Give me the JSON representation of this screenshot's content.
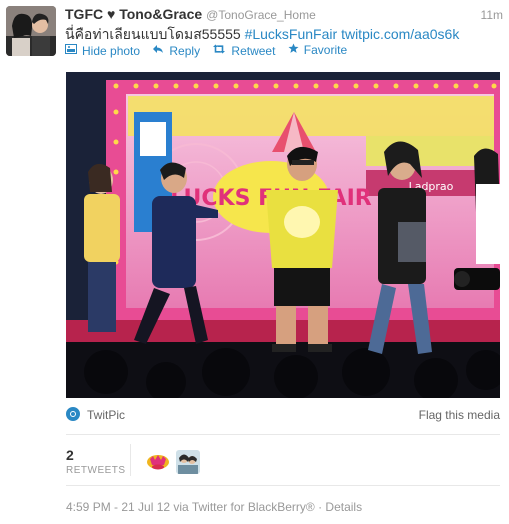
{
  "tweet": {
    "display_name": "TGFC ♥ Tono&Grace",
    "screen_name": "@TonoGrace_Home",
    "time_ago": "11m",
    "text_plain": "นี่คือท่าเลียนแบบโดมส55555",
    "hashtag": "#LucksFunFair",
    "link": "twitpic.com/aa0s6k"
  },
  "actions": {
    "hide_photo": "Hide photo",
    "reply": "Reply",
    "retweet": "Retweet",
    "favorite": "Favorite"
  },
  "media": {
    "banner_text": "LUCKS FUN FAIR",
    "location_text": "Ladprao",
    "provider": "TwitPic",
    "flag": "Flag this media"
  },
  "stats": {
    "retweet_count": "2",
    "retweets_label": "RETWEETS"
  },
  "meta": {
    "time": "4:59 PM - 21 Jul 12 via Twitter for BlackBerry®",
    "separator": "·",
    "details": "Details"
  },
  "colors": {
    "link": "#2a88c4",
    "text": "#333333",
    "muted": "#999999"
  },
  "icons": [
    "photo-icon",
    "reply-icon",
    "retweet-icon",
    "favorite-icon",
    "twitpic-icon"
  ]
}
